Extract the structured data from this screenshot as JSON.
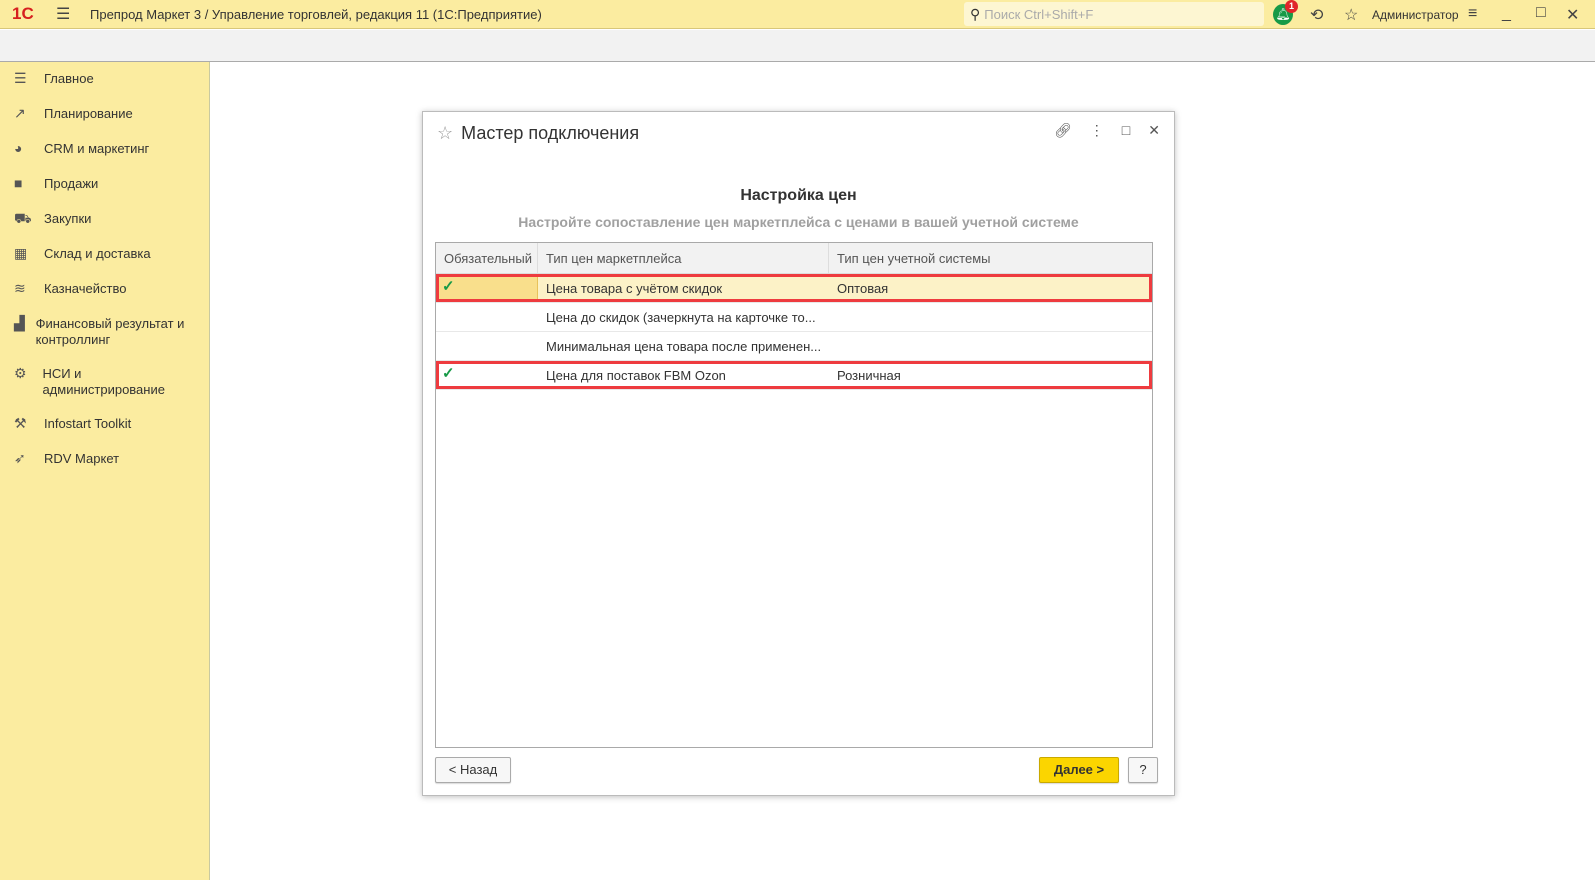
{
  "app": {
    "logo": "1С",
    "title": "Препрод Маркет 3 / Управление торговлей, редакция 11  (1С:Предприятие)",
    "search_placeholder": "Поиск Ctrl+Shift+F",
    "notifications_count": "1",
    "user": "Администратор"
  },
  "sidebar": {
    "items": [
      {
        "label": "Главное",
        "icon": "menu-icon"
      },
      {
        "label": "Планирование",
        "icon": "chart-up-icon"
      },
      {
        "label": "CRM и маркетинг",
        "icon": "pie-icon"
      },
      {
        "label": "Продажи",
        "icon": "bag-icon"
      },
      {
        "label": "Закупки",
        "icon": "cart-icon"
      },
      {
        "label": "Склад и доставка",
        "icon": "warehouse-icon"
      },
      {
        "label": "Казначейство",
        "icon": "coins-icon"
      },
      {
        "label": "Финансовый результат и контроллинг",
        "icon": "bar-chart-icon"
      },
      {
        "label": "НСИ и администрирование",
        "icon": "gear-icon"
      },
      {
        "label": "Infostart Toolkit",
        "icon": "tools-icon"
      },
      {
        "label": "RDV Маркет",
        "icon": "rocket-icon"
      }
    ]
  },
  "dialog": {
    "title": "Мастер подключения",
    "heading": "Настройка цен",
    "subheading": "Настройте сопоставление цен маркетплейса с ценами в вашей учетной системе",
    "columns": [
      "Обязательный",
      "Тип цен маркетплейса",
      "Тип цен учетной системы"
    ],
    "rows": [
      {
        "required": "✓",
        "marketplace": "Цена товара с учётом скидок",
        "system": "Оптовая"
      },
      {
        "required": "",
        "marketplace": "Цена до скидок (зачеркнута на карточке то...",
        "system": ""
      },
      {
        "required": "",
        "marketplace": "Минимальная цена товара после применен...",
        "system": ""
      },
      {
        "required": "✓",
        "marketplace": "Цена для поставок FBM Ozon",
        "system": "Розничная"
      }
    ],
    "back": "< Назад",
    "next": "Далее >",
    "help": "?"
  }
}
